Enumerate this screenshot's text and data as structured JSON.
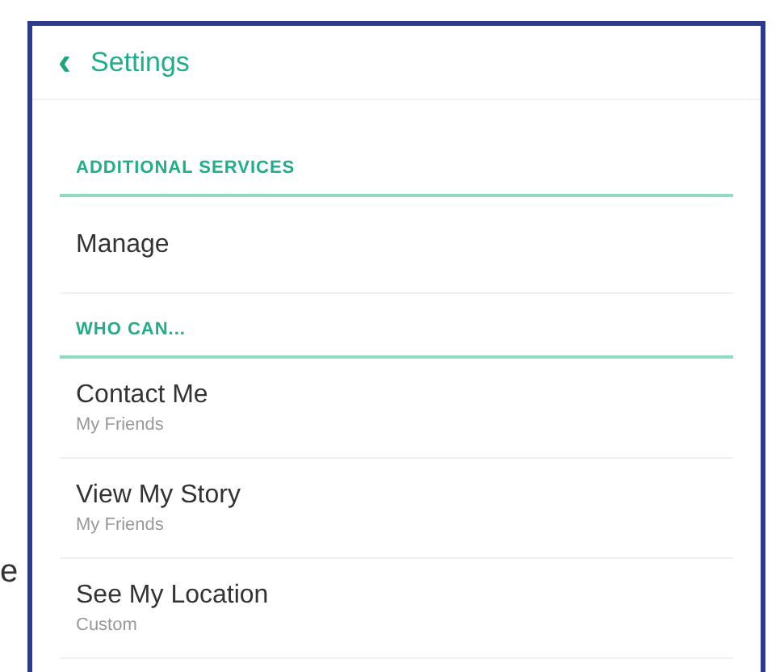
{
  "margin_fragment": "e",
  "header": {
    "back": "‹",
    "title": "Settings"
  },
  "sections": [
    {
      "header": "ADDITIONAL SERVICES",
      "items": [
        {
          "title": "Manage"
        }
      ]
    },
    {
      "header": "WHO CAN...",
      "items": [
        {
          "title": "Contact Me",
          "subtitle": "My Friends"
        },
        {
          "title": "View My Story",
          "subtitle": "My Friends"
        },
        {
          "title": "See My Location",
          "subtitle": "Custom"
        }
      ]
    }
  ]
}
